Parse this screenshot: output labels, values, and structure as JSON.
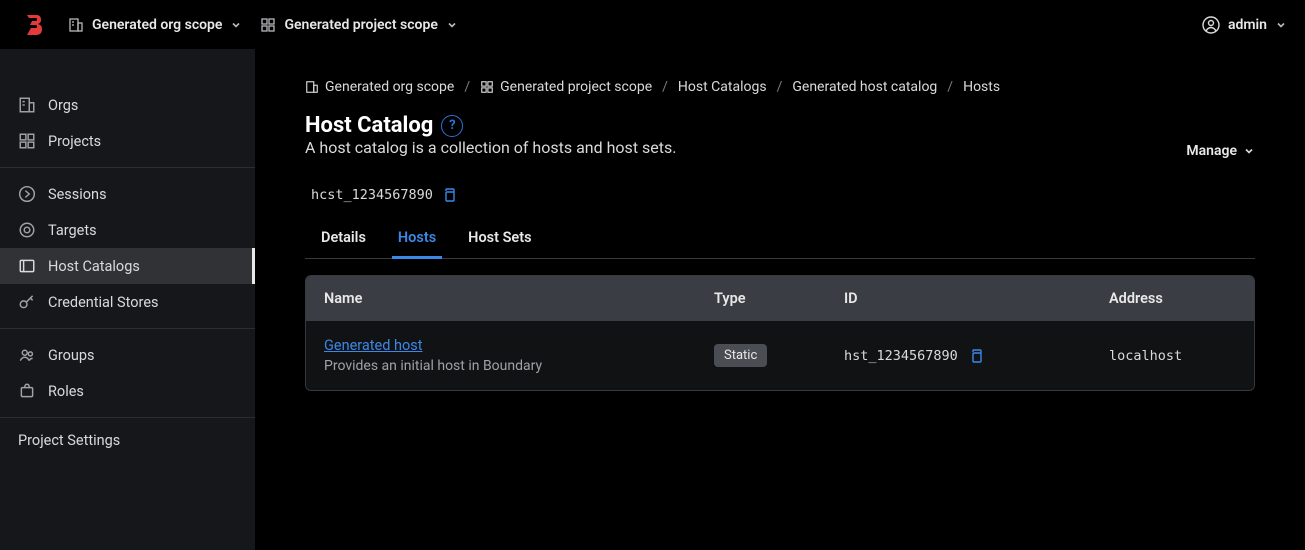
{
  "header": {
    "org_scope": "Generated org scope",
    "project_scope": "Generated project scope",
    "user": "admin"
  },
  "sidebar": {
    "items": [
      {
        "label": "Orgs"
      },
      {
        "label": "Projects"
      },
      {
        "label": "Sessions"
      },
      {
        "label": "Targets"
      },
      {
        "label": "Host Catalogs"
      },
      {
        "label": "Credential Stores"
      },
      {
        "label": "Groups"
      },
      {
        "label": "Roles"
      }
    ],
    "settings": "Project Settings"
  },
  "breadcrumb": [
    "Generated org scope",
    "Generated project scope",
    "Host Catalogs",
    "Generated host catalog",
    "Hosts"
  ],
  "page": {
    "title": "Host Catalog",
    "description": "A host catalog is a collection of hosts and host sets.",
    "id": "hcst_1234567890",
    "manage": "Manage"
  },
  "tabs": [
    {
      "label": "Details"
    },
    {
      "label": "Hosts"
    },
    {
      "label": "Host Sets"
    }
  ],
  "table": {
    "headers": [
      "Name",
      "Type",
      "ID",
      "Address"
    ],
    "rows": [
      {
        "name": "Generated host",
        "desc": "Provides an initial host in Boundary",
        "type": "Static",
        "id": "hst_1234567890",
        "address": "localhost"
      }
    ]
  }
}
